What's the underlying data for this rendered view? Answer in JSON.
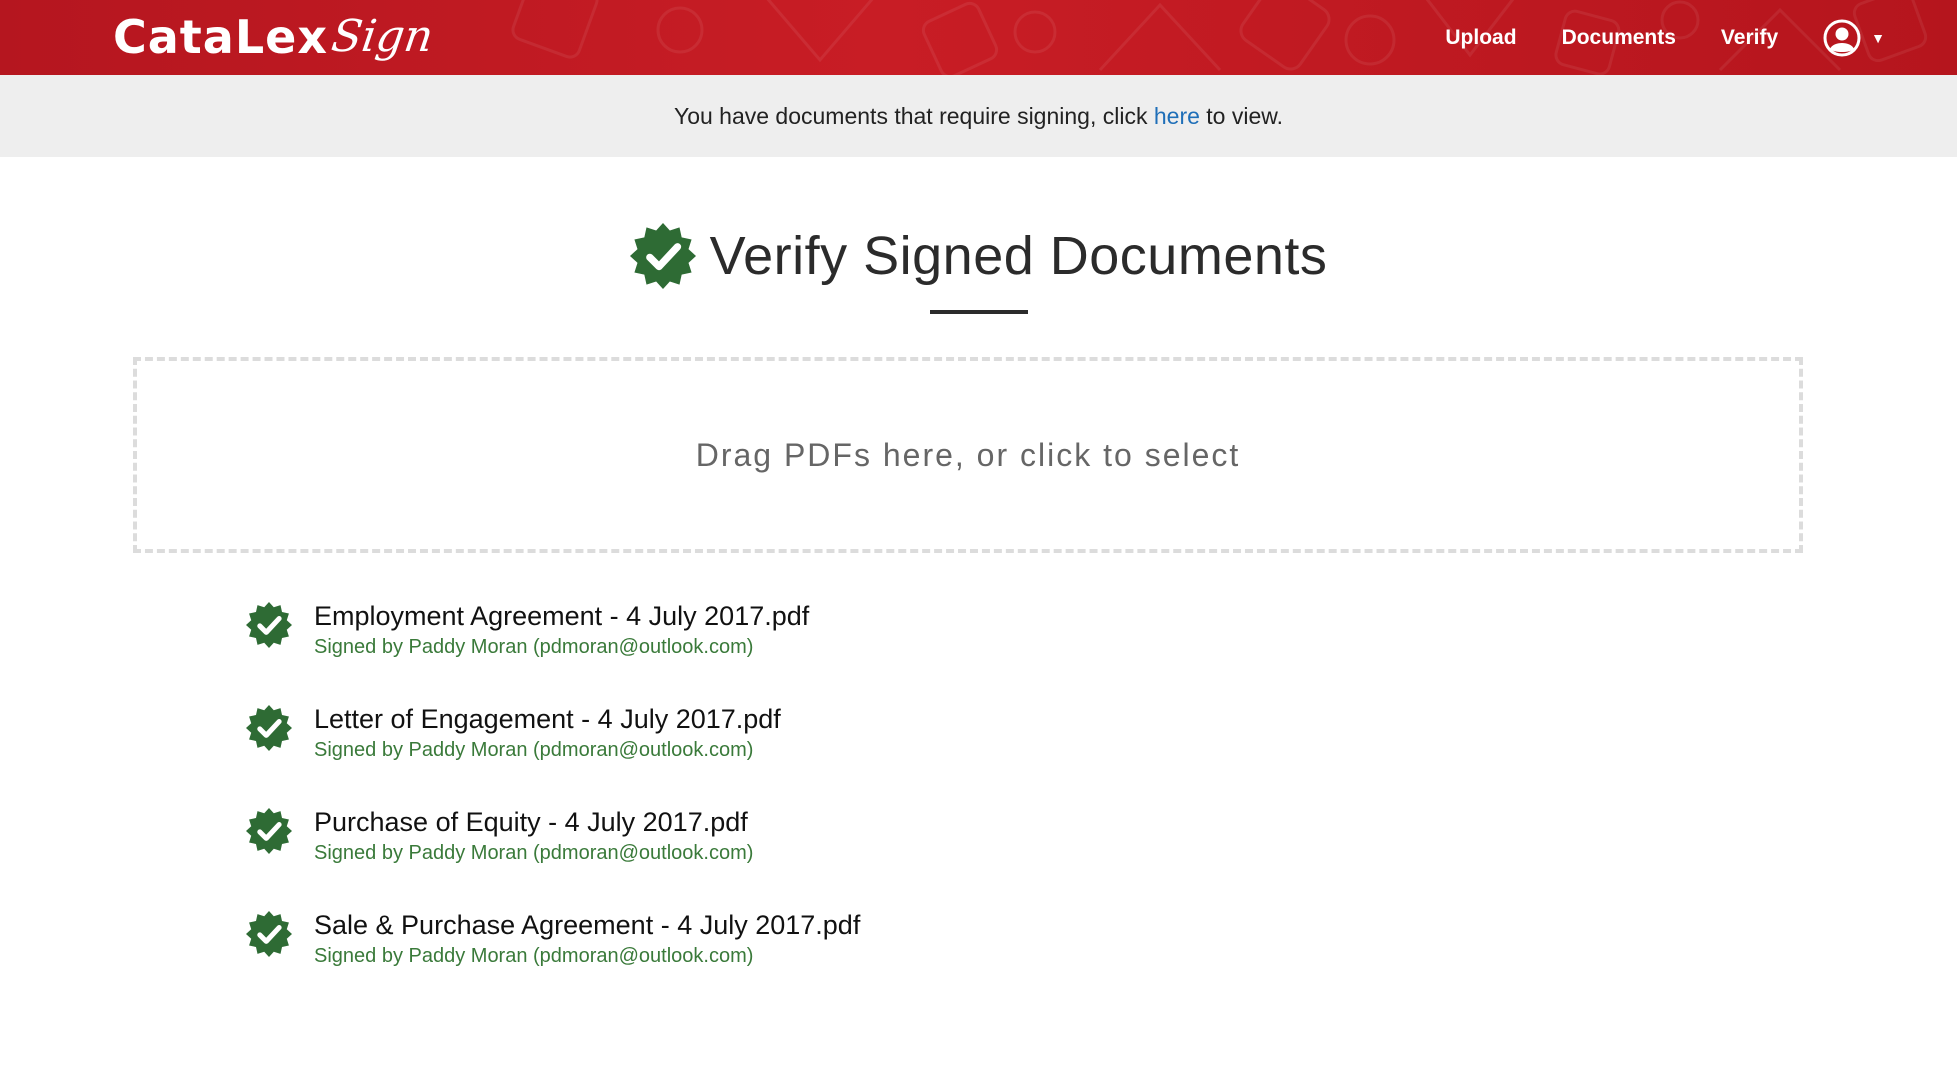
{
  "brand": {
    "main": "CataLex",
    "script": "Sign"
  },
  "nav": {
    "upload": "Upload",
    "documents": "Documents",
    "verify": "Verify",
    "user_icon": "user-circle-icon",
    "caret_icon": "caret-down-icon"
  },
  "notice": {
    "before": "You have documents that require signing, click ",
    "link": "here",
    "after": " to view."
  },
  "page": {
    "title": "Verify Signed Documents",
    "title_icon": "verified-badge-icon"
  },
  "dropzone": {
    "label": "Drag PDFs here, or click to select"
  },
  "documents": [
    {
      "name": "Employment Agreement - 4 July 2017.pdf",
      "signed": "Signed by Paddy Moran (pdmoran@outlook.com)"
    },
    {
      "name": "Letter of Engagement - 4 July 2017.pdf",
      "signed": "Signed by Paddy Moran (pdmoran@outlook.com)"
    },
    {
      "name": "Purchase of Equity - 4 July 2017.pdf",
      "signed": "Signed by Paddy Moran (pdmoran@outlook.com)"
    },
    {
      "name": "Sale & Purchase Agreement - 4 July 2017.pdf",
      "signed": "Signed by Paddy Moran (pdmoran@outlook.com)"
    }
  ],
  "colors": {
    "nav": "#c41c24",
    "badge": "#2e6b34",
    "link": "#1f6fb8",
    "signed": "#3a7a3a"
  }
}
